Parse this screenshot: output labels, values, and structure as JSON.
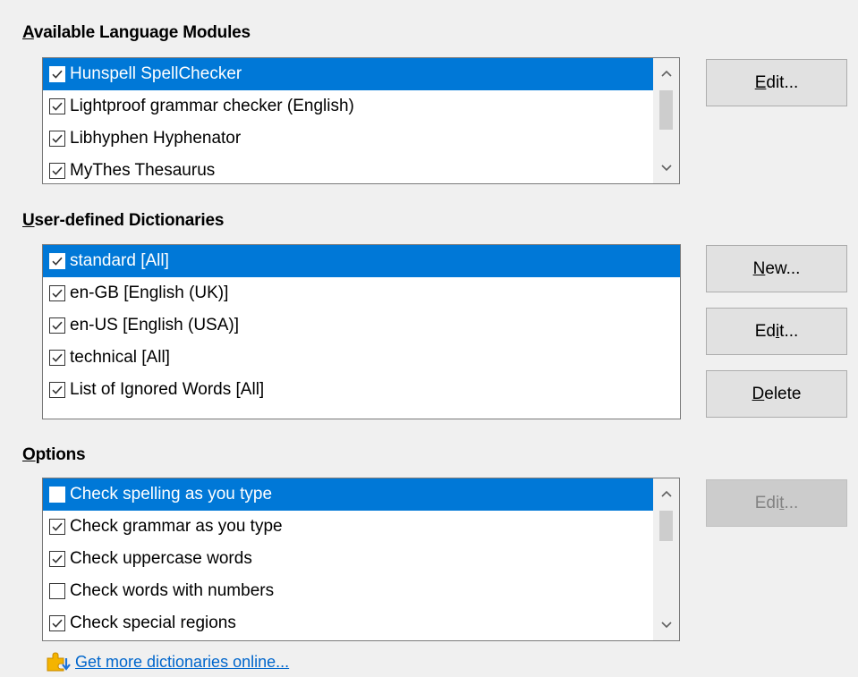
{
  "sections": {
    "modules": {
      "title_mnemonic": "A",
      "title_rest": "vailable Language Modules",
      "items": [
        {
          "label": "Hunspell SpellChecker",
          "checked": true,
          "selected": true
        },
        {
          "label": "Lightproof grammar checker (English)",
          "checked": true,
          "selected": false
        },
        {
          "label": "Libhyphen Hyphenator",
          "checked": true,
          "selected": false
        },
        {
          "label": "MyThes Thesaurus",
          "checked": true,
          "selected": false
        }
      ],
      "edit_button": {
        "pre": "",
        "mnemonic": "E",
        "post": "dit..."
      }
    },
    "dictionaries": {
      "title_mnemonic": "U",
      "title_rest": "ser-defined Dictionaries",
      "items": [
        {
          "label": "standard [All]",
          "checked": true,
          "selected": true
        },
        {
          "label": "en-GB [English (UK)]",
          "checked": true,
          "selected": false
        },
        {
          "label": "en-US [English (USA)]",
          "checked": true,
          "selected": false
        },
        {
          "label": "technical [All]",
          "checked": true,
          "selected": false
        },
        {
          "label": "List of Ignored Words [All]",
          "checked": true,
          "selected": false
        }
      ],
      "new_button": {
        "pre": "",
        "mnemonic": "N",
        "post": "ew..."
      },
      "edit_button": {
        "pre": "Ed",
        "mnemonic": "i",
        "post": "t..."
      },
      "delete_button": {
        "pre": "",
        "mnemonic": "D",
        "post": "elete"
      }
    },
    "options": {
      "title_mnemonic": "O",
      "title_rest": "ptions",
      "items": [
        {
          "label": "Check spelling as you type",
          "checked": false,
          "selected": true
        },
        {
          "label": "Check grammar as you type",
          "checked": true,
          "selected": false
        },
        {
          "label": "Check uppercase words",
          "checked": true,
          "selected": false
        },
        {
          "label": "Check words with numbers",
          "checked": false,
          "selected": false
        },
        {
          "label": "Check special regions",
          "checked": true,
          "selected": false
        }
      ],
      "edit_button": {
        "pre": "Edi",
        "mnemonic": "t",
        "post": "...",
        "disabled": true
      }
    }
  },
  "link": {
    "label": "Get more dictionaries online..."
  },
  "icons": {
    "checkmark": "checkmark-icon",
    "scroll_up": "chevron-up-icon",
    "scroll_down": "chevron-down-icon",
    "link": "download-extension-icon"
  },
  "colors": {
    "selection": "#0078d7",
    "link": "#0066cc",
    "window": "#f0f0f0"
  }
}
